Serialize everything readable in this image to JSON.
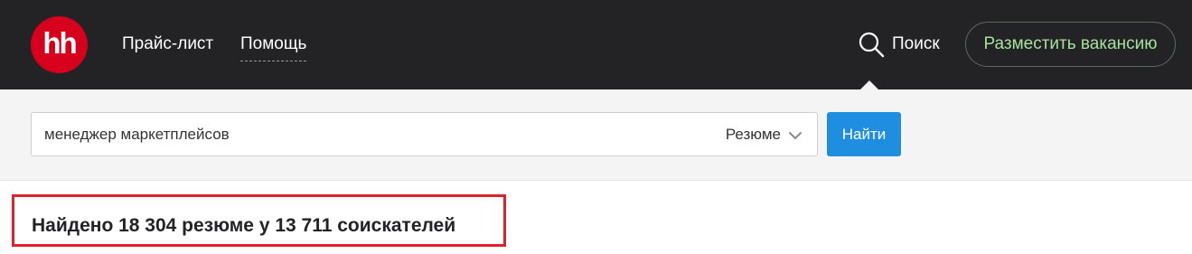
{
  "header": {
    "logo_text": "hh",
    "nav": [
      {
        "label": "Прайс-лист"
      },
      {
        "label": "Помощь"
      }
    ],
    "search_link_label": "Поиск",
    "post_vacancy_label": "Разместить вакансию"
  },
  "search": {
    "query": "менеджер маркетплейсов",
    "type_selected": "Резюме",
    "submit_label": "Найти"
  },
  "results": {
    "summary": "Найдено 18 304 резюме у 13 711 соискателей"
  },
  "colors": {
    "topbar_bg": "#232325",
    "logo_red": "#d6001c",
    "post_button_text": "#a5e09e",
    "find_button_bg": "#1f8ee0",
    "highlight_frame": "#e0202a",
    "search_band_bg": "#f4f4f4"
  },
  "icons": {
    "search": "search-icon",
    "dropdown": "chevron-down-icon"
  }
}
